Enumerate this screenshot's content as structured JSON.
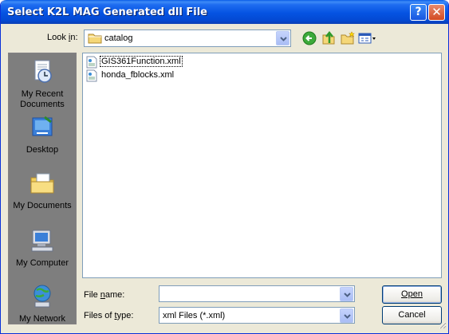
{
  "window": {
    "title": "Select K2L MAG Generated dll File",
    "help_glyph": "?",
    "close_glyph": "✕"
  },
  "lookin": {
    "label": "Look in:",
    "label_mnemonic": "i",
    "value": "catalog"
  },
  "toolbar": {
    "icons": [
      "back-icon",
      "up-folder-icon",
      "new-folder-icon",
      "views-menu-icon"
    ]
  },
  "places": [
    {
      "label": "My Recent Documents",
      "icon": "recent-documents-icon"
    },
    {
      "label": "Desktop",
      "icon": "desktop-icon"
    },
    {
      "label": "My Documents",
      "icon": "my-documents-icon"
    },
    {
      "label": "My Computer",
      "icon": "my-computer-icon"
    },
    {
      "label": "My Network",
      "icon": "my-network-icon"
    }
  ],
  "files": [
    {
      "name": "GIS361Function.xml",
      "selected": true
    },
    {
      "name": "honda_fblocks.xml",
      "selected": false
    }
  ],
  "filename": {
    "label": "File name:",
    "value": ""
  },
  "filetype": {
    "label": "Files of type:",
    "value": "xml Files (*.xml)"
  },
  "buttons": {
    "open": "Open",
    "cancel": "Cancel"
  },
  "colors": {
    "title_bar": "#0553E2",
    "dialog_bg": "#ECE9D8",
    "places_bar": "#7E7E7E",
    "field_border": "#7F9DB9",
    "button_border": "#003C74"
  }
}
